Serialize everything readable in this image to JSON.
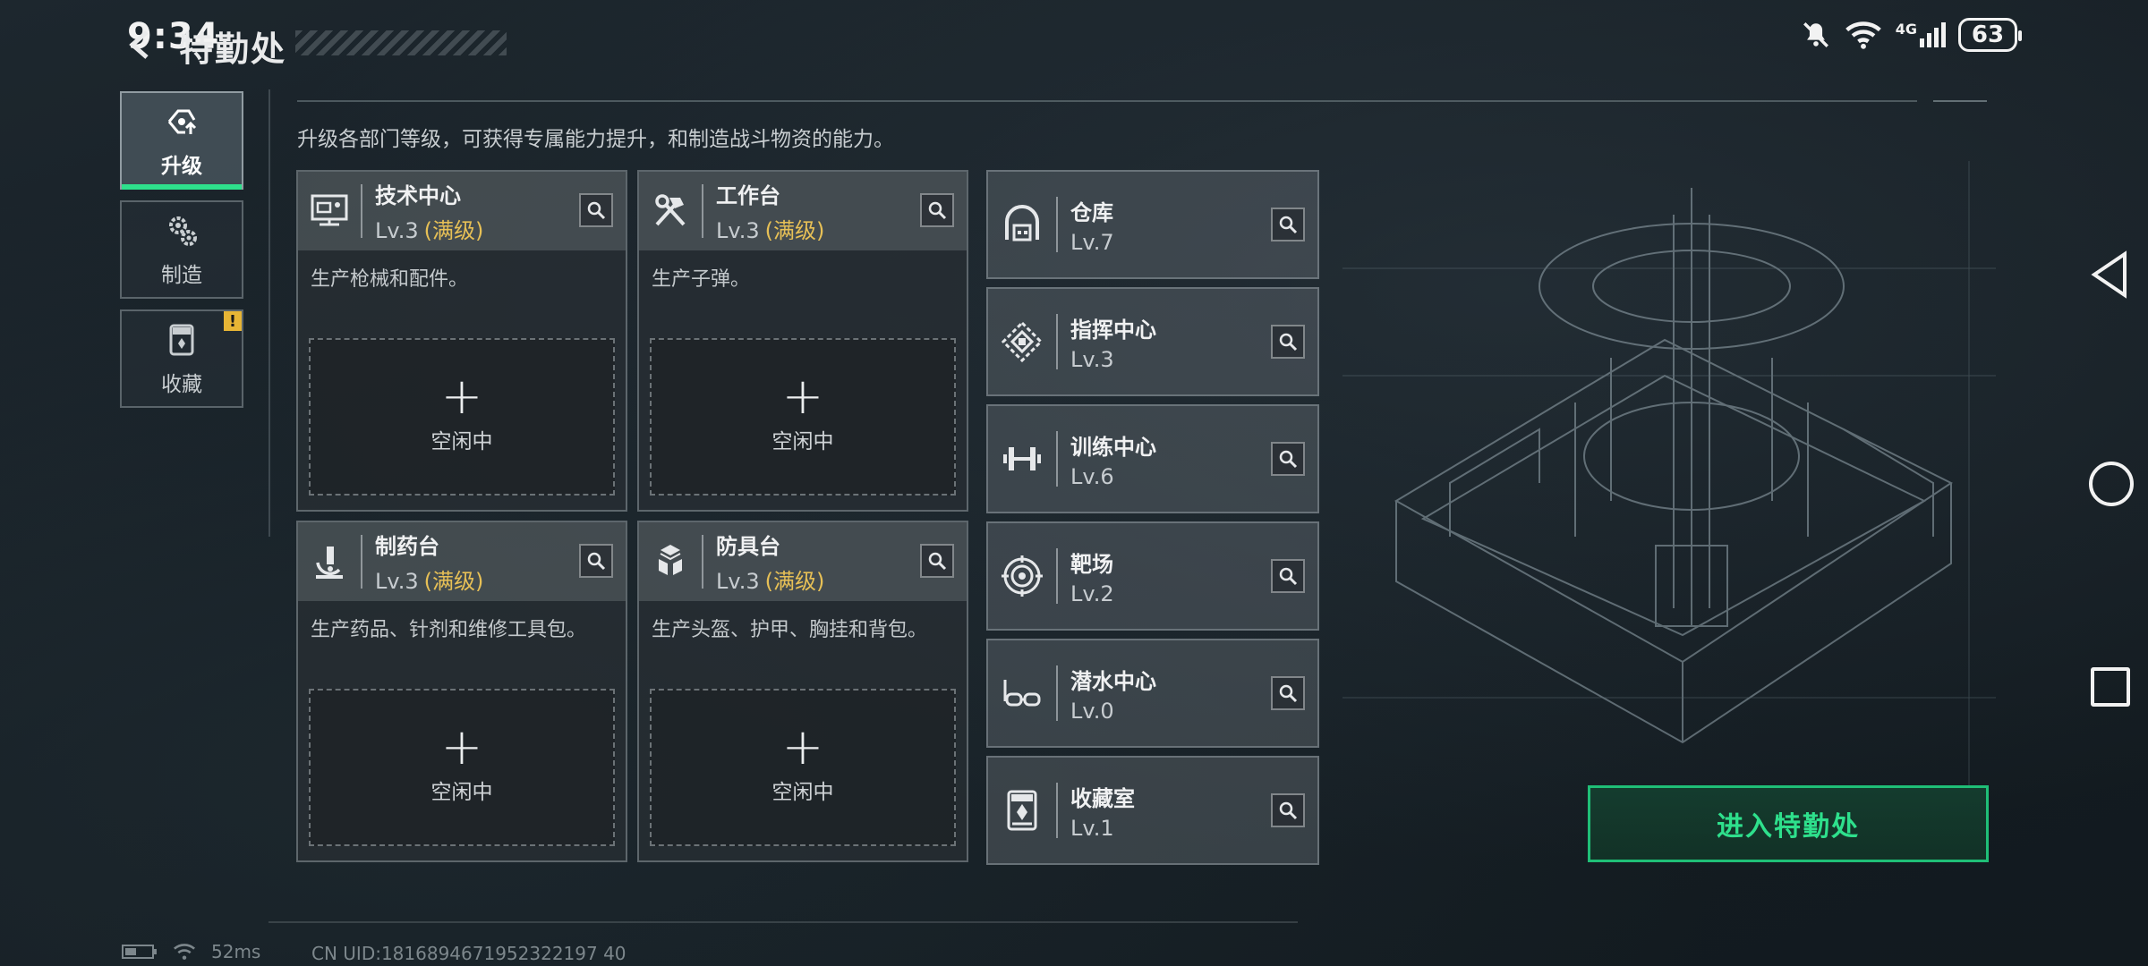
{
  "status_bar": {
    "time": "9:34",
    "network_label": "4G",
    "battery": "63"
  },
  "header": {
    "title": "特勤处"
  },
  "description": "升级各部门等级，可获得专属能力提升，和制造战斗物资的能力。",
  "sidebar": {
    "items": [
      {
        "label": "升级",
        "icon": "upgrade-icon",
        "active": true
      },
      {
        "label": "制造",
        "icon": "gear-icon",
        "active": false
      },
      {
        "label": "收藏",
        "icon": "collection-icon",
        "active": false,
        "badge": "!"
      }
    ]
  },
  "facilities": [
    {
      "name": "技术中心",
      "level": "Lv.3",
      "maxed": "(满级)",
      "desc": "生产枪械和配件。",
      "slot_status": "空闲中",
      "icon": "tech-center-icon"
    },
    {
      "name": "工作台",
      "level": "Lv.3",
      "maxed": "(满级)",
      "desc": "生产子弹。",
      "slot_status": "空闲中",
      "icon": "hammer-wrench-icon"
    },
    {
      "name": "制药台",
      "level": "Lv.3",
      "maxed": "(满级)",
      "desc": "生产药品、针剂和维修工具包。",
      "slot_status": "空闲中",
      "icon": "microscope-icon"
    },
    {
      "name": "防具台",
      "level": "Lv.3",
      "maxed": "(满级)",
      "desc": "生产头盔、护甲、胸挂和背包。",
      "slot_status": "空闲中",
      "icon": "armor-icon"
    }
  ],
  "departments": [
    {
      "name": "仓库",
      "level": "Lv.7",
      "icon": "warehouse-icon"
    },
    {
      "name": "指挥中心",
      "level": "Lv.3",
      "icon": "command-center-icon"
    },
    {
      "name": "训练中心",
      "level": "Lv.6",
      "icon": "dumbbell-icon"
    },
    {
      "name": "靶场",
      "level": "Lv.2",
      "icon": "target-icon"
    },
    {
      "name": "潜水中心",
      "level": "Lv.0",
      "icon": "diving-mask-icon"
    },
    {
      "name": "收藏室",
      "level": "Lv.1",
      "icon": "collection-room-icon"
    }
  ],
  "enter_button": "进入特勤处",
  "footer": {
    "ping": "52ms",
    "uid": "CN UID:1816894671952322197 40"
  },
  "colors": {
    "accent": "#2ee08c",
    "maxed": "#e7c056",
    "warning": "#e7b535"
  }
}
